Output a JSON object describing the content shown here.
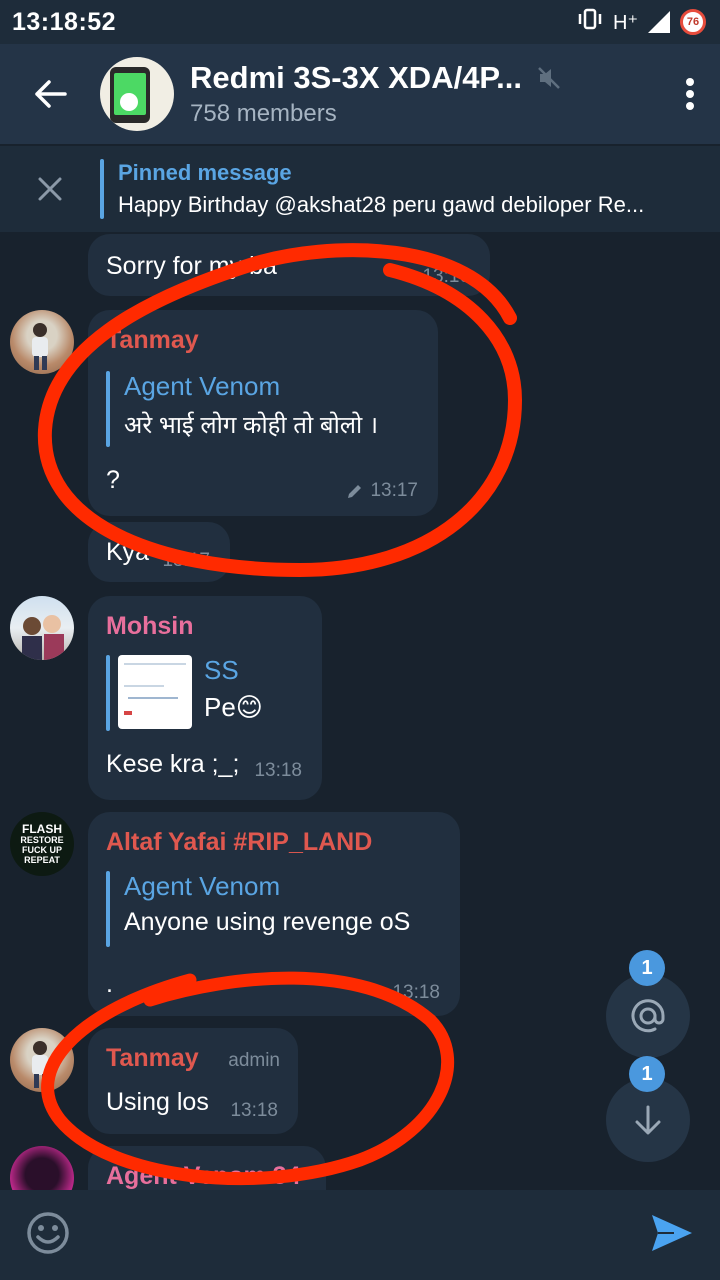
{
  "status_bar": {
    "time": "13:18:52",
    "network": "H⁺",
    "battery": "76"
  },
  "header": {
    "title": "Redmi 3S-3X XDA/4P...",
    "subtitle": "758 members"
  },
  "pinned": {
    "title": "Pinned message",
    "text": "Happy Birthday @akshat28 peru gawd debiloper  Re..."
  },
  "messages": [
    {
      "text": "Sorry for my ba",
      "time": "13:16"
    },
    {
      "sender": "Tanmay",
      "reply_name": "Agent Venom",
      "reply_text": "अरे भाई लोग कोही तो बोलो ।",
      "text": "?",
      "time": "13:17"
    },
    {
      "text": "Kya",
      "time": "13:17"
    },
    {
      "sender": "Mohsin",
      "reply_name": "SS",
      "reply_text": "Pe😊",
      "text": "Kese kra ;_;",
      "time": "13:18"
    },
    {
      "sender": "Altaf Yafai #RIP_LAND",
      "reply_name": "Agent Venom",
      "reply_text": "Anyone using revenge oS",
      "text": ".",
      "time": "13:18"
    },
    {
      "sender": "Tanmay",
      "badge": "admin",
      "text": "Using los",
      "time": "13:18"
    },
    {
      "sender": "Agent Venom 34"
    }
  ],
  "avatar_texts": [
    "FLASH",
    "RESTORE",
    "FUCK UP",
    "REPEAT"
  ],
  "fabs": {
    "mentions_count": "1",
    "down_count": "1"
  },
  "colors": {
    "background": "#18222d",
    "header": "#243447",
    "bubble": "#212f3f",
    "accent": "#5aa5e3",
    "sender_red": "#e0584f",
    "sender_pink": "#e86f9c",
    "annotation": "#ff2a00"
  },
  "icons": [
    "back-arrow-icon",
    "mute-icon",
    "more-vert-icon",
    "close-icon",
    "edit-pencil-icon",
    "at-icon",
    "arrow-down-icon",
    "emoji-icon",
    "send-icon"
  ]
}
